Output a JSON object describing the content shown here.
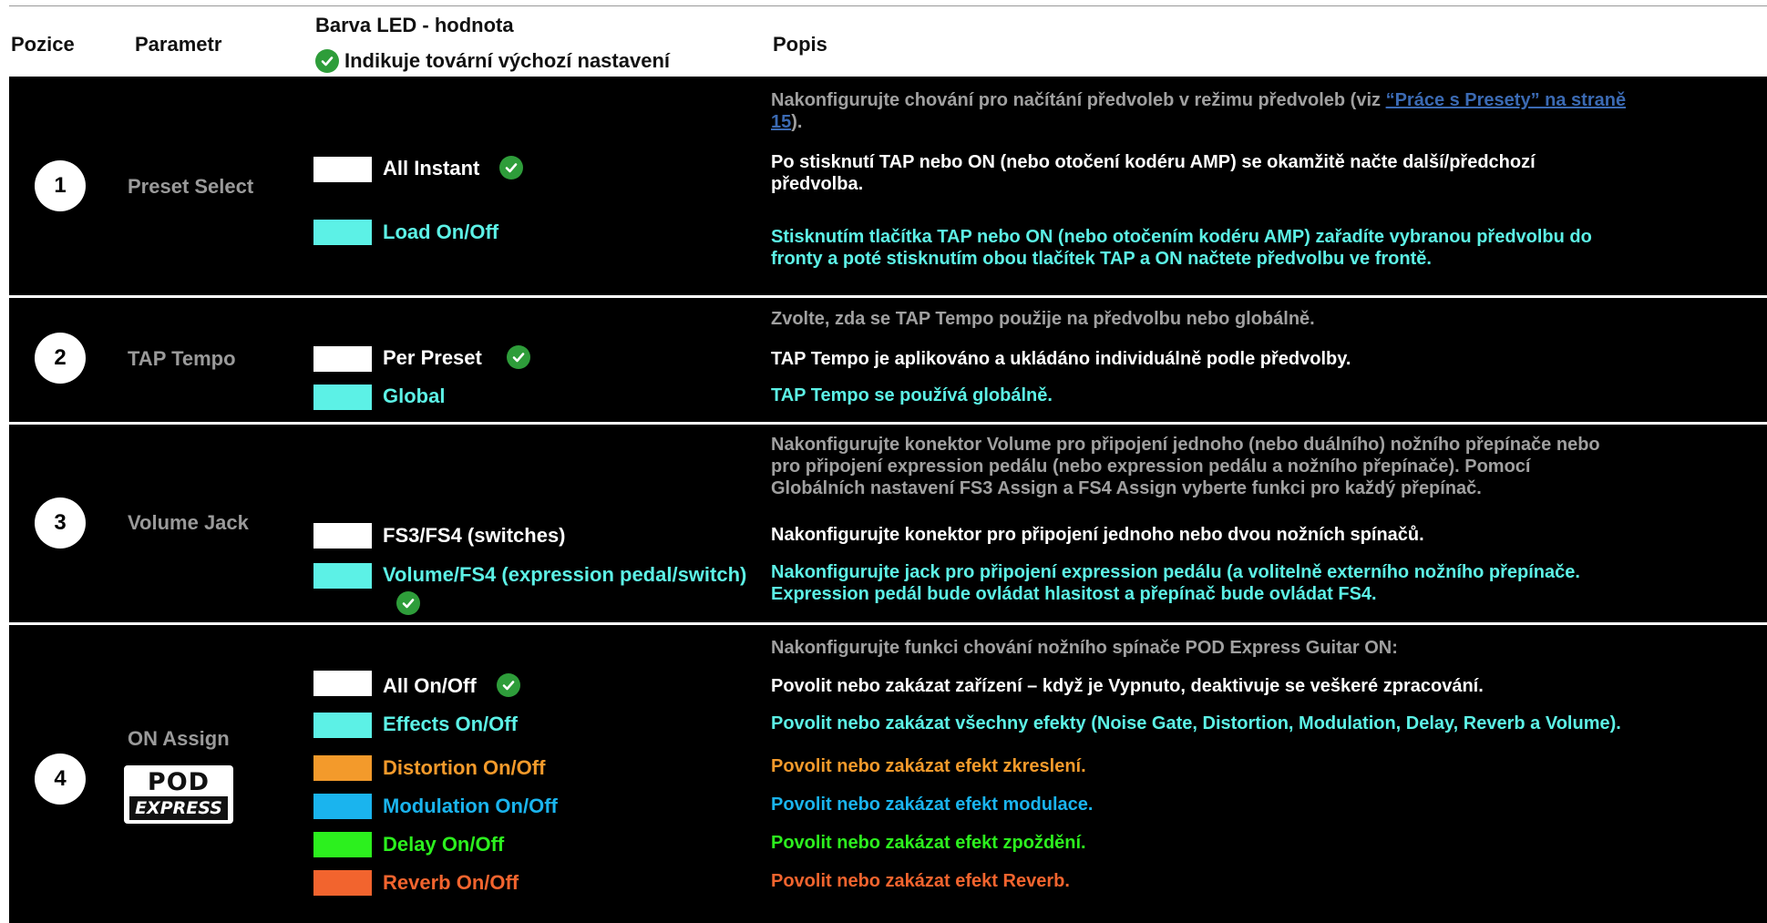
{
  "header": {
    "col_position": "Pozice",
    "col_parameter": "Parametr",
    "col_led": "Barva LED - hodnota",
    "col_led_note": "Indikuje tovární výchozí nastavení",
    "col_description": "Popis"
  },
  "rows": [
    {
      "number": "1",
      "parameter": "Preset Select",
      "intro_text": "Nakonfigurujte chování pro načítání předvoleb v režimu předvoleb (viz ",
      "intro_link_line1": "“Práce s Presety” na straně",
      "intro_link_line2": "15",
      "intro_tail": ").",
      "options": [
        {
          "label": "All Instant",
          "color": "#ffffff",
          "default": true,
          "desc_line1": "Po stisknutí TAP nebo ON (nebo otočení kodéru AMP) se okamžitě načte další/předchozí",
          "desc_line2": "předvolba."
        },
        {
          "label": "Load On/Off",
          "color": "#5cf1e6",
          "default": false,
          "desc_line1": "Stisknutím tlačítka TAP nebo ON (nebo otočením kodéru AMP) zařadíte vybranou předvolbu do",
          "desc_line2": "fronty a poté stisknutím obou tlačítek TAP a ON načtete předvolbu ve frontě."
        }
      ]
    },
    {
      "number": "2",
      "parameter": "TAP Tempo",
      "intro_text": "Zvolte, zda se TAP Tempo použije na předvolbu nebo globálně.",
      "options": [
        {
          "label": "Per Preset",
          "color": "#ffffff",
          "default": true,
          "desc_line1": "TAP Tempo je aplikováno a ukládáno individuálně podle předvolby."
        },
        {
          "label": "Global",
          "color": "#5cf1e6",
          "default": false,
          "desc_line1": "TAP Tempo se používá globálně."
        }
      ]
    },
    {
      "number": "3",
      "parameter": "Volume Jack",
      "intro_line1": "Nakonfigurujte konektor Volume pro připojení jednoho (nebo duálního) nožního přepínače nebo",
      "intro_line2": "pro připojení expression pedálu (nebo expression pedálu a nožního přepínače). Pomocí",
      "intro_line3": "Globálních nastavení FS3 Assign a FS4 Assign vyberte funkci pro každý přepínač.",
      "options": [
        {
          "label": "FS3/FS4 (switches)",
          "color": "#ffffff",
          "default": false,
          "desc_line1": "Nakonfigurujte konektor pro připojení jednoho nebo dvou nožních spínačů."
        },
        {
          "label": "Volume/FS4 (expression pedal/switch)",
          "color": "#5cf1e6",
          "default": true,
          "desc_line1": "Nakonfigurujte jack pro připojení expression pedálu (a volitelně externího nožního přepínače.",
          "desc_line2": "Expression pedál bude ovládat hlasitost a přepínač bude ovládat FS4."
        }
      ]
    },
    {
      "number": "4",
      "parameter": "ON Assign",
      "logo_top": "POD",
      "logo_bottom": "EXPRESS",
      "intro_text": "Nakonfigurujte funkci chování nožního spínače POD Express Guitar ON:",
      "options": [
        {
          "label": "All On/Off",
          "color": "#ffffff",
          "default": true,
          "desc_line1": "Povolit nebo zakázat zařízení – když je Vypnuto, deaktivuje se veškeré zpracování."
        },
        {
          "label": "Effects On/Off",
          "color": "#5cf1e6",
          "default": false,
          "desc_line1": "Povolit nebo zakázat všechny efekty (Noise Gate, Distortion, Modulation, Delay, Reverb a Volume)."
        },
        {
          "label": "Distortion On/Off",
          "color": "#f39a2b",
          "default": false,
          "desc_line1": "Povolit nebo zakázat efekt zkreslení."
        },
        {
          "label": "Modulation On/Off",
          "color": "#1ab4ee",
          "default": false,
          "desc_line1": "Povolit nebo zakázat efekt modulace."
        },
        {
          "label": "Delay On/Off",
          "color": "#2cf01e",
          "default": false,
          "desc_line1": "Povolit nebo zakázat efekt zpoždění."
        },
        {
          "label": "Reverb On/Off",
          "color": "#f2642e",
          "default": false,
          "desc_line1": "Povolit nebo zakázat efekt Reverb."
        }
      ]
    }
  ]
}
